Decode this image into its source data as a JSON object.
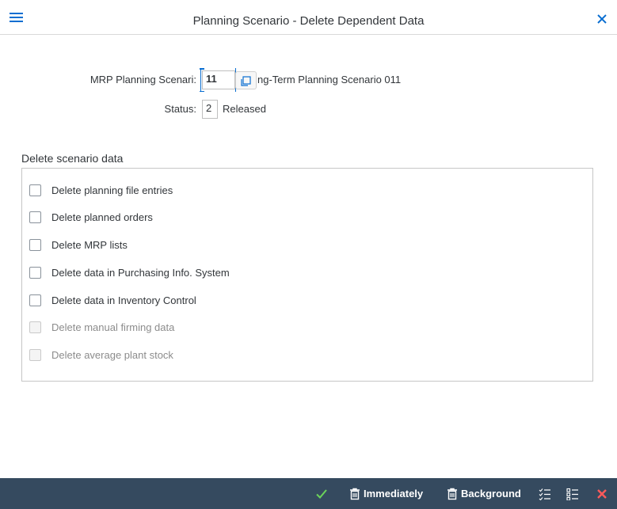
{
  "window": {
    "title": "Planning Scenario - Delete Dependent Data",
    "menu_icon": "hamburger-menu-icon",
    "close_icon": "close-icon"
  },
  "form": {
    "scenario_label": "MRP Planning Scenari:",
    "scenario_value": "11",
    "scenario_description": "ng-Term Planning Scenario 011",
    "status_label": "Status:",
    "status_value": "2",
    "status_text": "Released"
  },
  "section": {
    "title": "Delete scenario data",
    "options": [
      {
        "label": "Delete planning file entries",
        "checked": false,
        "enabled": true
      },
      {
        "label": "Delete planned orders",
        "checked": false,
        "enabled": true
      },
      {
        "label": "Delete MRP lists",
        "checked": false,
        "enabled": true
      },
      {
        "label": "Delete data in Purchasing Info. System",
        "checked": false,
        "enabled": true
      },
      {
        "label": "Delete data in Inventory Control",
        "checked": false,
        "enabled": true
      },
      {
        "label": "Delete manual firming data",
        "checked": false,
        "enabled": false
      },
      {
        "label": "Delete average plant stock",
        "checked": false,
        "enabled": false
      }
    ]
  },
  "footer": {
    "immediately_label": "Immediately",
    "background_label": "Background",
    "icons": [
      "checkmark-icon",
      "trash-icon",
      "select-all-icon",
      "deselect-all-icon",
      "cancel-icon"
    ]
  },
  "colors": {
    "accent": "#0a6ed1",
    "footer_bg": "#354a5f",
    "confirm_green": "#6bd35a",
    "cancel_red": "#ff5a5a"
  }
}
